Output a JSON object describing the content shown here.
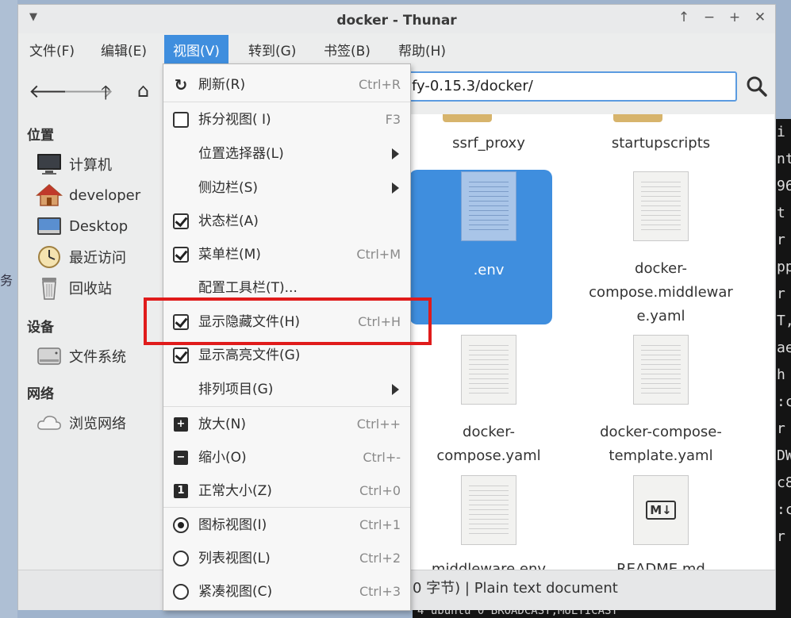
{
  "window": {
    "title": "docker - Thunar"
  },
  "menubar": [
    "文件(F)",
    "编辑(E)",
    "视图(V)",
    "转到(G)",
    "书签(B)",
    "帮助(H)"
  ],
  "location_path": "fy-0.15.3/docker/",
  "sidebar": {
    "places_heading": "位置",
    "places": [
      "计算机",
      "developer",
      "Desktop",
      "最近访问",
      "回收站"
    ],
    "devices_heading": "设备",
    "devices": [
      "文件系统"
    ],
    "network_heading": "网络",
    "network": [
      "浏览网络"
    ]
  },
  "files": [
    {
      "name": "ssrf_proxy",
      "type": "folder"
    },
    {
      "name": "startupscripts",
      "type": "folder"
    },
    {
      "name": ".env",
      "type": "text",
      "selected": true
    },
    {
      "name": "docker-compose.middleware.yaml",
      "line1": "docker-",
      "line2": "compose.middlewar",
      "line3": "e.yaml",
      "type": "text"
    },
    {
      "name": "docker-compose.yaml",
      "line1": "docker-",
      "line2": "compose.yaml",
      "type": "text"
    },
    {
      "name": "docker-compose-template.yaml",
      "line1": "docker-compose-",
      "line2": "template.yaml",
      "type": "text"
    },
    {
      "name": "middleware.env",
      "type": "text"
    },
    {
      "name": "README.md",
      "type": "markdown"
    }
  ],
  "status": "0 字节) | Plain text document",
  "view_menu": {
    "items": [
      {
        "label": "刷新(R)",
        "accel": "Ctrl+R",
        "indicator": "refresh"
      },
      {
        "label": "拆分视图( I)",
        "accel": "F3",
        "indicator": "checkbox",
        "checked": false
      },
      {
        "label": "位置选择器(L)",
        "submenu": true
      },
      {
        "label": "侧边栏(S)",
        "submenu": true
      },
      {
        "label": "状态栏(A)",
        "indicator": "checkbox",
        "checked": true
      },
      {
        "label": "菜单栏(M)",
        "accel": "Ctrl+M",
        "indicator": "checkbox",
        "checked": true
      },
      {
        "label": "配置工具栏(T)..."
      },
      {
        "label": "显示隐藏文件(H)",
        "accel": "Ctrl+H",
        "indicator": "checkbox",
        "checked": true
      },
      {
        "label": "显示高亮文件(G)",
        "indicator": "checkbox",
        "checked": true
      },
      {
        "label": "排列项目(G)",
        "submenu": true
      },
      {
        "label": "放大(N)",
        "accel": "Ctrl++",
        "indicator": "zoom-in"
      },
      {
        "label": "缩小(O)",
        "accel": "Ctrl+-",
        "indicator": "zoom-out"
      },
      {
        "label": "正常大小(Z)",
        "accel": "Ctrl+0",
        "indicator": "zoom-normal"
      },
      {
        "label": "图标视图(I)",
        "accel": "Ctrl+1",
        "indicator": "radio",
        "checked": true
      },
      {
        "label": "列表视图(L)",
        "accel": "Ctrl+2",
        "indicator": "radio",
        "checked": false
      },
      {
        "label": "紧凑视图(C)",
        "accel": "Ctrl+3",
        "indicator": "radio",
        "checked": false
      }
    ]
  },
  "terminal_lines": [
    "i",
    "nt",
    "96",
    "t",
    "r",
    "pp",
    "r",
    "T,",
    "ae",
    "h",
    ":c",
    "r",
    "DW",
    "c8",
    ":c",
    "r"
  ],
  "terminal_bottom": "4 ubuntu 0   BROADCAST,MULTICAST",
  "desktop_glyph": "务",
  "colors": {
    "accent": "#3f8ede",
    "highlight": "#e01b1b"
  }
}
